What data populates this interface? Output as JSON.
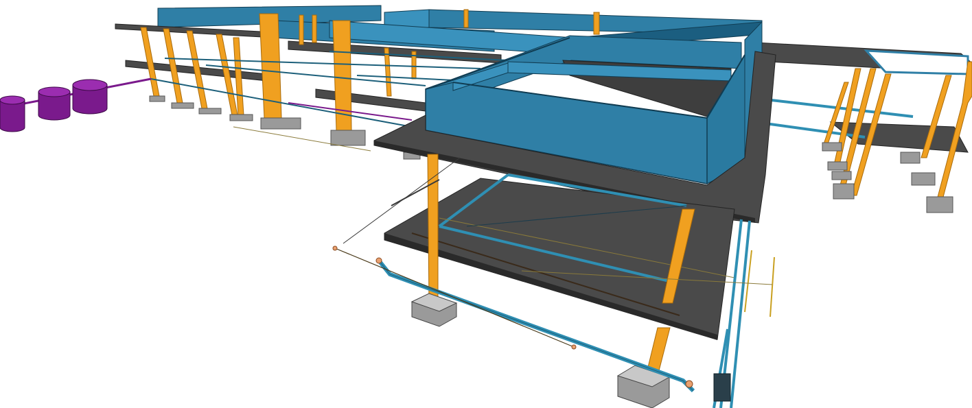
{
  "viewport": {
    "background": "#ffffff",
    "colors": {
      "wall": "#2f7fa6",
      "wall_light": "#3a92bd",
      "wall_top": "#1b5e80",
      "slab": "#4a4a4a",
      "slab_edge": "#2a2a2a",
      "column": "#f0a020",
      "column_dark": "#c97f0f",
      "footing": "#9a9a9a",
      "footing_top": "#c8c8c8",
      "pipe_blue": "#2f8fb3",
      "pipe_dark": "#1c5f7a",
      "tank": "#7a1a8c",
      "tank_top": "#9b2db0",
      "fitting": "#e8a070",
      "wire": "#8a7a3a"
    },
    "objects": [
      "water-tank",
      "building-slab",
      "structural-column",
      "column-footing",
      "exterior-wall",
      "water-pipe",
      "drain-pipe",
      "pipe-fitting"
    ]
  }
}
